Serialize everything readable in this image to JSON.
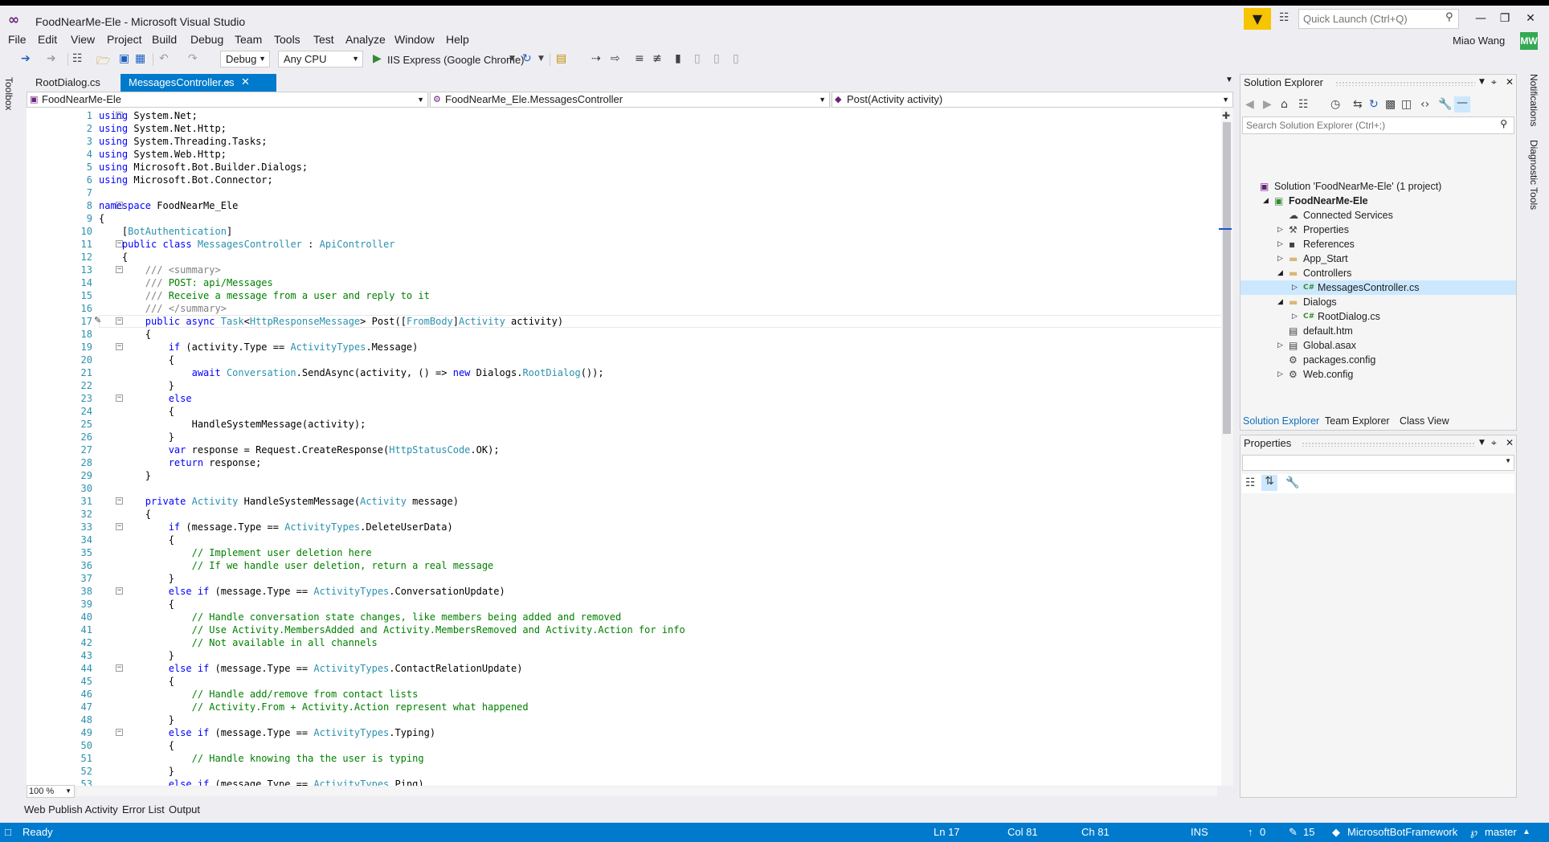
{
  "window": {
    "title": "FoodNearMe-Ele - Microsoft Visual Studio",
    "quick_launch_placeholder": "Quick Launch (Ctrl+Q)",
    "user_name": "Miao Wang",
    "avatar_initials": "MW",
    "accent_color": "#007acc",
    "brand_color": "#68217a"
  },
  "menu": [
    "File",
    "Edit",
    "View",
    "Project",
    "Build",
    "Debug",
    "Team",
    "Tools",
    "Test",
    "Analyze",
    "Window",
    "Help"
  ],
  "toolbar": {
    "config": "Debug",
    "platform": "Any CPU",
    "run_target": "IIS Express (Google Chrome)"
  },
  "side_labels": {
    "left": "Toolbox",
    "right_top": "Notifications",
    "right_bottom": "Diagnostic Tools"
  },
  "tabs": [
    {
      "label": "RootDialog.cs",
      "active": false
    },
    {
      "label": "MessagesController.cs",
      "active": true
    }
  ],
  "nav": {
    "project": "FoodNearMe-Ele",
    "type": "FoodNearMe_Ele.MessagesController",
    "member": "Post(Activity activity)"
  },
  "editor": {
    "zoom": "100 %",
    "current_line": 17,
    "lines": [
      "using System.Net;",
      "using System.Net.Http;",
      "using System.Threading.Tasks;",
      "using System.Web.Http;",
      "using Microsoft.Bot.Builder.Dialogs;",
      "using Microsoft.Bot.Connector;",
      "",
      "namespace FoodNearMe_Ele",
      "{",
      "    [BotAuthentication]",
      "    public class MessagesController : ApiController",
      "    {",
      "        /// <summary>",
      "        /// POST: api/Messages",
      "        /// Receive a message from a user and reply to it",
      "        /// </summary>",
      "        public async Task<HttpResponseMessage> Post([FromBody]Activity activity)",
      "        {",
      "            if (activity.Type == ActivityTypes.Message)",
      "            {",
      "                await Conversation.SendAsync(activity, () => new Dialogs.RootDialog());",
      "            }",
      "            else",
      "            {",
      "                HandleSystemMessage(activity);",
      "            }",
      "            var response = Request.CreateResponse(HttpStatusCode.OK);",
      "            return response;",
      "        }",
      "",
      "        private Activity HandleSystemMessage(Activity message)",
      "        {",
      "            if (message.Type == ActivityTypes.DeleteUserData)",
      "            {",
      "                // Implement user deletion here",
      "                // If we handle user deletion, return a real message",
      "            }",
      "            else if (message.Type == ActivityTypes.ConversationUpdate)",
      "            {",
      "                // Handle conversation state changes, like members being added and removed",
      "                // Use Activity.MembersAdded and Activity.MembersRemoved and Activity.Action for info",
      "                // Not available in all channels",
      "            }",
      "            else if (message.Type == ActivityTypes.ContactRelationUpdate)",
      "            {",
      "                // Handle add/remove from contact lists",
      "                // Activity.From + Activity.Action represent what happened",
      "            }",
      "            else if (message.Type == ActivityTypes.Typing)",
      "            {",
      "                // Handle knowing tha the user is typing",
      "            }",
      "            else if (message.Type == ActivityTypes.Ping)"
    ]
  },
  "bottom_tabs": [
    "Web Publish Activity",
    "Error List",
    "Output"
  ],
  "solution_explorer": {
    "title": "Solution Explorer",
    "search_placeholder": "Search Solution Explorer (Ctrl+;)",
    "items": [
      {
        "label": "Solution 'FoodNearMe-Ele' (1 project)",
        "icon": "solution-icon",
        "expander": ""
      },
      {
        "label": "FoodNearMe-Ele",
        "icon": "csharp-project-icon",
        "expander": "expanded",
        "bold": true
      },
      {
        "label": "Connected Services",
        "icon": "connected-services-icon",
        "expander": ""
      },
      {
        "label": "Properties",
        "icon": "wrench-icon",
        "expander": "collapsed"
      },
      {
        "label": "References",
        "icon": "references-icon",
        "expander": "collapsed"
      },
      {
        "label": "App_Start",
        "icon": "folder-icon",
        "expander": "collapsed"
      },
      {
        "label": "Controllers",
        "icon": "folder-icon",
        "expander": "expanded"
      },
      {
        "label": "MessagesController.cs",
        "icon": "csharp-file-icon",
        "expander": "collapsed",
        "selected": true
      },
      {
        "label": "Dialogs",
        "icon": "folder-icon",
        "expander": "expanded"
      },
      {
        "label": "RootDialog.cs",
        "icon": "csharp-file-icon",
        "expander": "collapsed"
      },
      {
        "label": "default.htm",
        "icon": "html-file-icon",
        "expander": ""
      },
      {
        "label": "Global.asax",
        "icon": "asax-file-icon",
        "expander": "collapsed"
      },
      {
        "label": "packages.config",
        "icon": "config-file-icon",
        "expander": ""
      },
      {
        "label": "Web.config",
        "icon": "config-file-icon",
        "expander": "collapsed"
      }
    ],
    "tabs": [
      "Solution Explorer",
      "Team Explorer",
      "Class View"
    ]
  },
  "properties": {
    "title": "Properties"
  },
  "status": {
    "ready": "Ready",
    "ln": "Ln 17",
    "col": "Col 81",
    "ch": "Ch 81",
    "ins": "INS",
    "up_count": "0",
    "pending_count": "15",
    "repo": "MicrosoftBotFramework",
    "branch": "master"
  }
}
